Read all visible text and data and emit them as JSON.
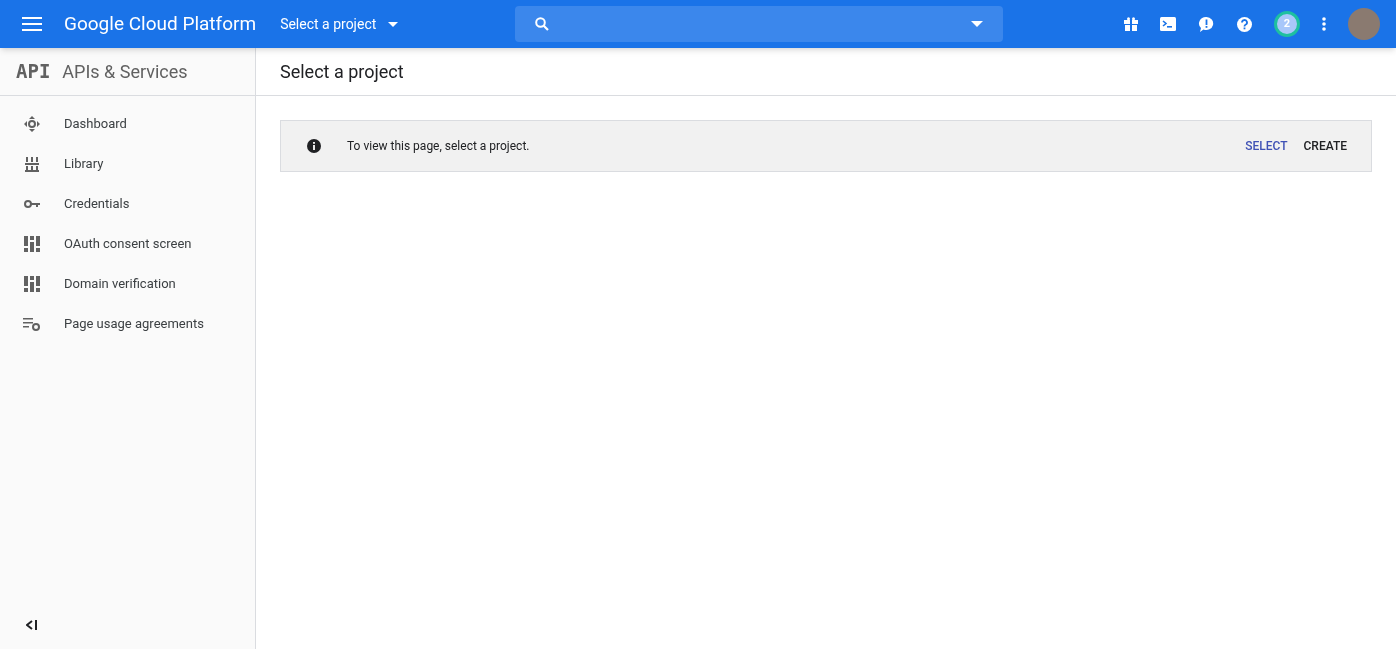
{
  "header": {
    "brand": "Google Cloud Platform",
    "project_picker": "Select a project",
    "notification_count": "2"
  },
  "sidebar": {
    "logo": "API",
    "title": "APIs & Services",
    "items": [
      {
        "kind": "dashboard",
        "label": "Dashboard"
      },
      {
        "kind": "library",
        "label": "Library"
      },
      {
        "kind": "credentials",
        "label": "Credentials"
      },
      {
        "kind": "consent",
        "label": "OAuth consent screen"
      },
      {
        "kind": "consent",
        "label": "Domain verification"
      },
      {
        "kind": "agreements",
        "label": "Page usage agreements"
      }
    ]
  },
  "main": {
    "title": "Select a project",
    "banner": {
      "message": "To view this page, select a project.",
      "actions": [
        {
          "label": "SELECT",
          "kind": "primary"
        },
        {
          "label": "CREATE",
          "kind": "plain"
        }
      ]
    }
  }
}
